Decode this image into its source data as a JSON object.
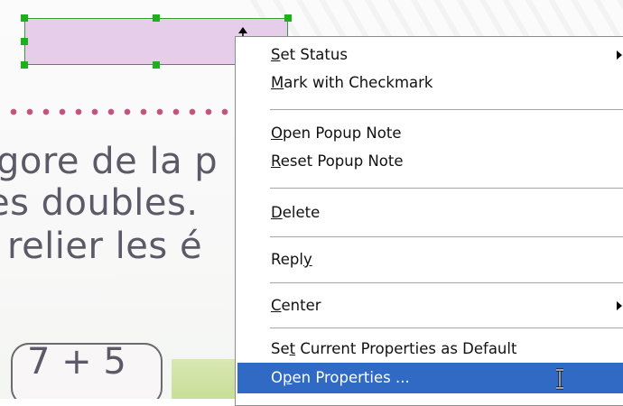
{
  "document": {
    "line1": "gore de la p",
    "line2": "es doubles.",
    "line3": "relier les é",
    "equation": "7 + 5",
    "annotation_color": "#e6cde9",
    "handle_color": "#1bb11b",
    "dots_color": "#c0557f"
  },
  "context_menu": {
    "highlight_color": "#316ac5",
    "items": [
      {
        "pre": "",
        "u": "S",
        "post": "et Status",
        "submenu": true
      },
      {
        "pre": "",
        "u": "M",
        "post": "ark with Checkmark",
        "submenu": false
      },
      {
        "pre": "",
        "u": "O",
        "post": "pen Popup Note",
        "submenu": false
      },
      {
        "pre": "",
        "u": "R",
        "post": "eset Popup Note",
        "submenu": false
      },
      {
        "pre": "",
        "u": "D",
        "post": "elete",
        "submenu": false
      },
      {
        "pre": "Repl",
        "u": "y",
        "post": "",
        "submenu": false
      },
      {
        "pre": "",
        "u": "C",
        "post": "enter",
        "submenu": true
      },
      {
        "pre": "Se",
        "u": "t",
        "post": " Current Properties as Default",
        "submenu": false
      },
      {
        "pre": "O",
        "u": "p",
        "post": "en Properties ...",
        "submenu": false,
        "highlighted": true
      }
    ]
  }
}
